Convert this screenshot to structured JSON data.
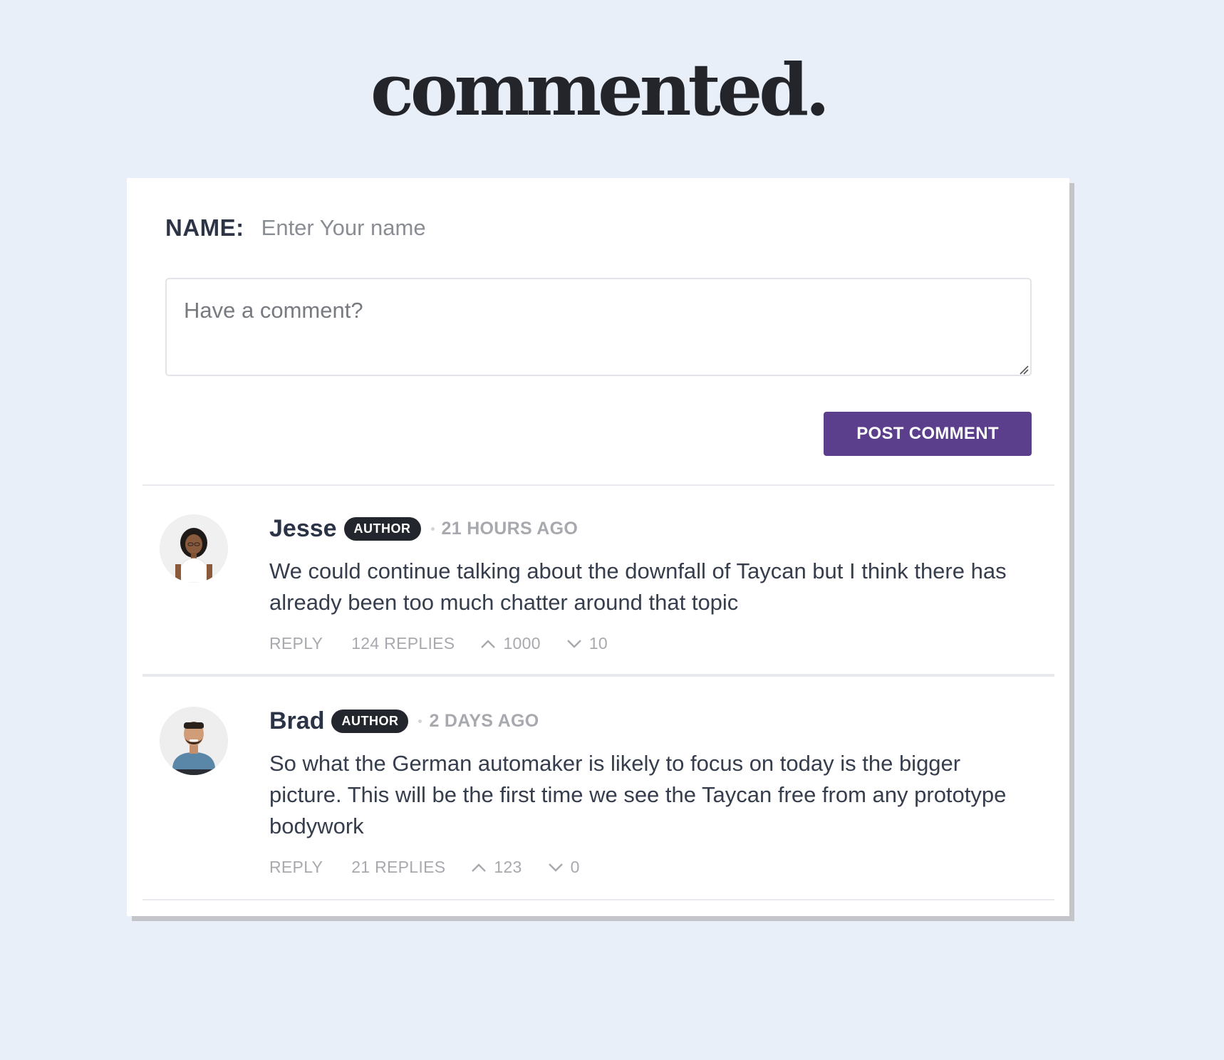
{
  "app": {
    "title": "commented."
  },
  "form": {
    "name_label": "NAME:",
    "name_placeholder": "Enter Your name",
    "comment_placeholder": "Have a comment?",
    "post_label": "POST COMMENT"
  },
  "colors": {
    "background": "#e8eff8",
    "accent": "#5b3f8c",
    "badge": "#23262c"
  },
  "comments": [
    {
      "author": "Jesse",
      "badge": "AUTHOR",
      "time": "21 HOURS AGO",
      "text": "We could continue talking about the downfall of Taycan but I think there has already been too much chatter around that topic",
      "reply_label": "REPLY",
      "replies": "124 REPLIES",
      "upvotes": "1000",
      "downvotes": "10",
      "avatar_icon": "avatar-woman"
    },
    {
      "author": "Brad",
      "badge": "AUTHOR",
      "time": "2 DAYS AGO",
      "text": "So what the German automaker is likely to focus on today is the bigger picture. This will be the first time we see the Taycan free from any prototype bodywork",
      "reply_label": "REPLY",
      "replies": "21 REPLIES",
      "upvotes": "123",
      "downvotes": "0",
      "avatar_icon": "avatar-man"
    }
  ]
}
